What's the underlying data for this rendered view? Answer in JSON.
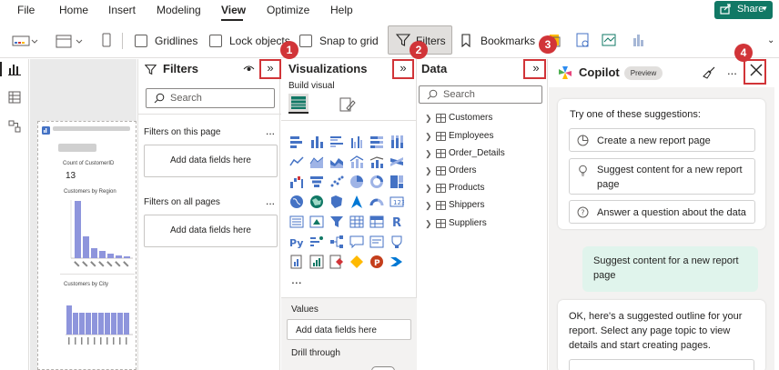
{
  "menu": {
    "items": [
      "File",
      "Home",
      "Insert",
      "Modeling",
      "View",
      "Optimize",
      "Help"
    ],
    "active": "View",
    "share_label": "Share"
  },
  "ribbon": {
    "gridlines_label": "Gridlines",
    "lock_objects_label": "Lock objects",
    "snap_to_grid_label": "Snap to grid",
    "filters_label": "Filters",
    "bookmarks_label": "Bookmarks"
  },
  "canvas": {
    "card_title": "Count of CustomerID",
    "card_value": "13",
    "chart1_title": "Customers by Region",
    "chart2_title": "Customers by City"
  },
  "filters_pane": {
    "title": "Filters",
    "search_placeholder": "Search",
    "on_this_page": "Filters on this page",
    "on_all_pages": "Filters on all pages",
    "add_fields": "Add data fields here",
    "more": "..."
  },
  "viz_pane": {
    "title": "Visualizations",
    "build_visual": "Build visual",
    "more": "...",
    "values_label": "Values",
    "add_fields": "Add data fields here",
    "drill_through": "Drill through"
  },
  "data_pane": {
    "title": "Data",
    "search_placeholder": "Search",
    "tables": [
      "Customers",
      "Employees",
      "Order_Details",
      "Orders",
      "Products",
      "Shippers",
      "Suppliers"
    ]
  },
  "copilot": {
    "title": "Copilot",
    "preview": "Preview",
    "more": "...",
    "intro": "Try one of these suggestions:",
    "suggestions": {
      "s1": "Create a new report page",
      "s2_line1": "Suggest content for a new report",
      "s2_line2": "page",
      "s3": "Answer a question about the data"
    },
    "user_message": "Suggest content for a new report page",
    "reply_line1": "OK, here's a suggested outline for your",
    "reply_line2": "report. Select any page topic to view",
    "reply_line3": "details and start creating pages."
  },
  "callouts": [
    "1",
    "2",
    "3",
    "4"
  ],
  "colors": {
    "callout_red": "#d13438",
    "share_green": "#117865",
    "copilot_user_bubble": "#e0f4ec",
    "bar_color": "#8e95dc"
  }
}
